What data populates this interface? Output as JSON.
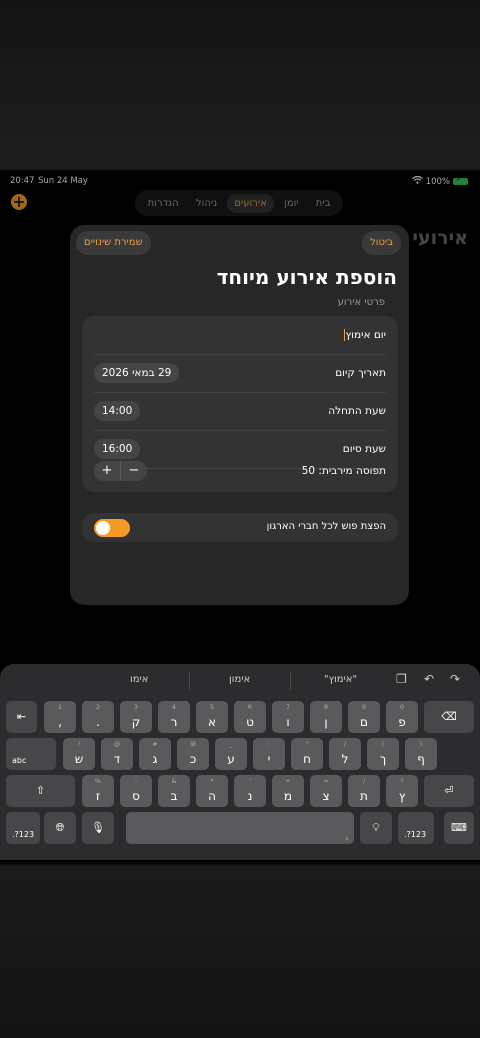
{
  "status": {
    "time": "20:47",
    "date": "Sun 24 May",
    "battery": "100%"
  },
  "nav": {
    "tabs": [
      {
        "label": "בית"
      },
      {
        "label": "יומן"
      },
      {
        "label": "אירועים"
      },
      {
        "label": "ניהול"
      },
      {
        "label": "הגדרות"
      }
    ],
    "active_tab": "אירועים",
    "bg_title": "אירועי"
  },
  "sheet": {
    "cancel_label": "ביטול",
    "save_label": "שמירת שינויים",
    "title": "הוספת אירוע מיוחד",
    "section_label": "פרטי אירוע",
    "name_value": "יום אימוץ",
    "date_label": "תאריך קיום",
    "date_value": "29 במאי 2026",
    "start_label": "שעת התחלה",
    "start_value": "14:00",
    "end_label": "שעת סיום",
    "end_value": "16:00",
    "capacity_label": "תפוסה מירבית: 50",
    "stepper_minus": "−",
    "stepper_plus": "+",
    "push_label": "הפצת פוש לכל חברי הארגון",
    "push_enabled": true
  },
  "keyboard": {
    "suggestions": [
      "\"אימוץ\"",
      "אימון",
      "אימו"
    ],
    "accent_color": "#f59a23",
    "rows": {
      "r1": [
        {
          "main": ",",
          "alt": "1"
        },
        {
          "main": ".",
          "alt": "2"
        },
        {
          "main": "ק",
          "alt": "3"
        },
        {
          "main": "ר",
          "alt": "4"
        },
        {
          "main": "א",
          "alt": "5"
        },
        {
          "main": "ט",
          "alt": "6"
        },
        {
          "main": "ו",
          "alt": "7"
        },
        {
          "main": "ן",
          "alt": "8"
        },
        {
          "main": "ם",
          "alt": "9"
        },
        {
          "main": "פ",
          "alt": "0"
        }
      ],
      "r2": [
        {
          "main": "ש",
          "alt": "!"
        },
        {
          "main": "ד",
          "alt": "@"
        },
        {
          "main": "ג",
          "alt": "#"
        },
        {
          "main": "כ",
          "alt": "₪"
        },
        {
          "main": "ע",
          "alt": "_"
        },
        {
          "main": "י",
          "alt": ":"
        },
        {
          "main": "ח",
          "alt": "\""
        },
        {
          "main": "ל",
          "alt": "/"
        },
        {
          "main": "ך",
          "alt": "("
        },
        {
          "main": "ף",
          "alt": ")"
        }
      ],
      "r3": [
        {
          "main": "ז",
          "alt": "%"
        },
        {
          "main": "ס",
          "alt": "-"
        },
        {
          "main": "ב",
          "alt": "&"
        },
        {
          "main": "ה",
          "alt": "*"
        },
        {
          "main": "נ",
          "alt": "'"
        },
        {
          "main": "מ",
          "alt": "+"
        },
        {
          "main": "צ",
          "alt": "="
        },
        {
          "main": "ת",
          "alt": "/"
        },
        {
          "main": "ץ",
          "alt": "?"
        }
      ]
    },
    "abc_label": "abc",
    "num_label": ".?123",
    "space_alt": "ג"
  }
}
